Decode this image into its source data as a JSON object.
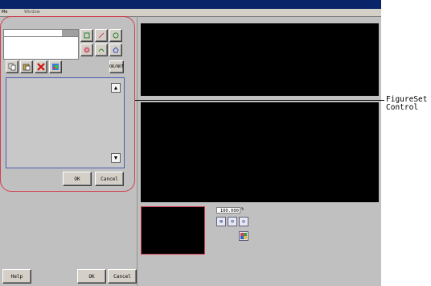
{
  "window": {
    "menu_tabs": [
      "Me",
      "Window"
    ]
  },
  "figure_editor": {
    "or_not_label": "OR/NOT",
    "ok_label": "OK",
    "cancel_label": "Cancel"
  },
  "zoom": {
    "value": "100.000",
    "unit": "%"
  },
  "footer": {
    "help_label": "Help",
    "ok_label": "OK",
    "cancel_label": "Cancel"
  },
  "annotation": {
    "line1": "FigureSet",
    "line2": "Control"
  },
  "icons": {
    "shape_tools": [
      "rectangle-icon",
      "line-icon",
      "circle-icon",
      "ellipse-icon",
      "wide-arc-icon",
      "polygon-icon"
    ],
    "edit_tools": [
      "copy-icon",
      "paste-icon",
      "delete-icon",
      "color-icon"
    ],
    "zoom_tools": [
      "zoom-in-icon",
      "zoom-out-icon",
      "zoom-fit-icon",
      "image-settings-icon"
    ]
  },
  "colors": {
    "highlight": "#d04050",
    "list_border": "#4a5cb0",
    "titlebar": "#0a246a"
  }
}
